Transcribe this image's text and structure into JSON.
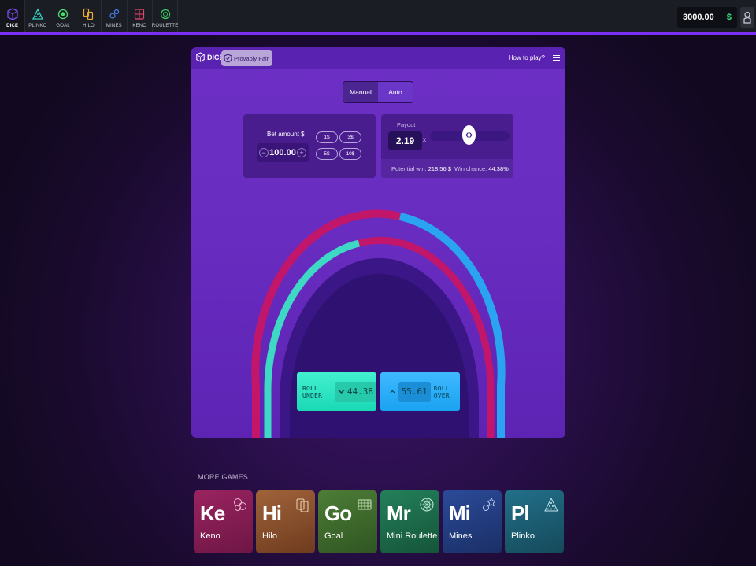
{
  "nav": {
    "items": [
      {
        "label": "DICE",
        "icon": "dice-icon",
        "color": "#7a4df2",
        "active": true
      },
      {
        "label": "PLINKO",
        "icon": "plinko-icon",
        "color": "#36d3c4"
      },
      {
        "label": "GOAL",
        "icon": "goal-icon",
        "color": "#4be06e"
      },
      {
        "label": "HILO",
        "icon": "hilo-icon",
        "color": "#e8a83a"
      },
      {
        "label": "MINES",
        "icon": "mines-icon",
        "color": "#4a7ff0"
      },
      {
        "label": "KENO",
        "icon": "keno-icon",
        "color": "#e8456e"
      },
      {
        "label": "ROULETTE",
        "icon": "roulette-icon",
        "color": "#3ec466"
      }
    ]
  },
  "balance": {
    "amount": "3000.00",
    "currency": "$"
  },
  "game": {
    "title": "DICE",
    "provably_fair": "Provably Fair",
    "how_to_play": "How to play?",
    "modes": {
      "manual": "Manual",
      "auto": "Auto"
    },
    "bet": {
      "label": "Bet amount $",
      "value": "100.00",
      "minus": "−",
      "plus": "+",
      "chips": [
        "1$",
        "3$",
        "5$",
        "10$"
      ]
    },
    "payout": {
      "label": "Payout",
      "value": "2.19",
      "x": "x",
      "potential_win_label": "Potential win:",
      "potential_win_value": "218.56 $",
      "win_chance_label": "Win chance:",
      "win_chance_value": "44.38%"
    },
    "roll_under": {
      "label": "ROLL UNDER",
      "value": "44.38"
    },
    "roll_over": {
      "label": "ROLL OVER",
      "value": "55.61"
    },
    "colors": {
      "win": "#3ed9c4",
      "lose": "#c2166a",
      "over": "#2aa4f0"
    }
  },
  "more_games": {
    "title": "MORE GAMES",
    "items": [
      {
        "abbr": "Ke",
        "name": "Keno",
        "icon": "keno-balls-icon",
        "color": "#8a1d55"
      },
      {
        "abbr": "Hi",
        "name": "Hilo",
        "icon": "hilo-cards-icon",
        "color": "#8c4f2a"
      },
      {
        "abbr": "Go",
        "name": "Goal",
        "icon": "goal-grid-icon",
        "color": "#3f6d2f"
      },
      {
        "abbr": "Mr",
        "name": "Mini Roulette",
        "icon": "roulette-wheel-icon",
        "color": "#1f6a4a"
      },
      {
        "abbr": "Mi",
        "name": "Mines",
        "icon": "mines-stars-icon",
        "color": "#233c7e"
      },
      {
        "abbr": "Pl",
        "name": "Plinko",
        "icon": "plinko-pyramid-icon",
        "color": "#1d5a6e"
      }
    ]
  }
}
